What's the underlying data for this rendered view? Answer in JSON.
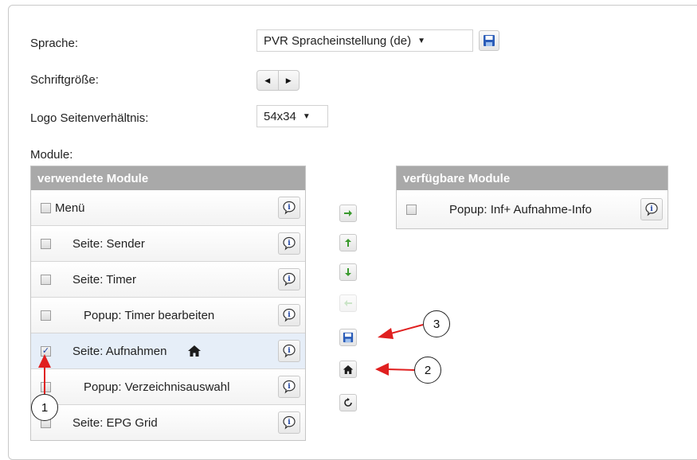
{
  "settings": {
    "language_label": "Sprache:",
    "language_value": "PVR Spracheinstellung (de)",
    "font_size_label": "Schriftgröße:",
    "logo_ratio_label": "Logo Seitenverhältnis:",
    "logo_ratio_value": "54x34",
    "modules_label": "Module:"
  },
  "used_modules": {
    "title": "verwendete Module",
    "items": [
      {
        "label": "Menü",
        "checked": false
      },
      {
        "label": "Seite: Sender",
        "checked": false
      },
      {
        "label": "Seite: Timer",
        "checked": false
      },
      {
        "label": "Popup: Timer bearbeiten",
        "checked": false
      },
      {
        "label": "Seite: Aufnahmen",
        "checked": true,
        "home": true
      },
      {
        "label": "Popup: Verzeichnisauswahl",
        "checked": false
      },
      {
        "label": "Seite: EPG Grid",
        "checked": false
      }
    ]
  },
  "available_modules": {
    "title": "verfügbare Module",
    "items": [
      {
        "label": "Popup: Inf+ Aufnahme-Info",
        "checked": false
      }
    ]
  },
  "controls": [
    "arrow-right-icon",
    "arrow-up-icon",
    "arrow-down-icon",
    "arrow-left-icon",
    "save-icon",
    "home-icon",
    "reset-icon"
  ],
  "callouts": {
    "c1": "1",
    "c2": "2",
    "c3": "3"
  },
  "colors": {
    "header": "#a9a9a9",
    "arrow_green": "#3a9a2e",
    "callout_arrow": "#e02020",
    "selected_row": "#e6eef8"
  }
}
